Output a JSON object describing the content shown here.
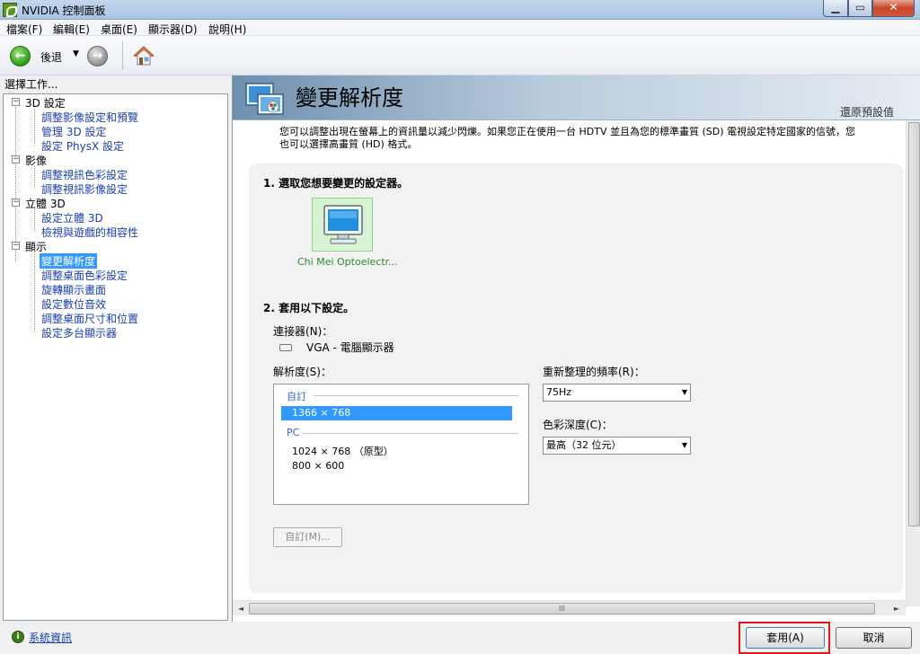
{
  "window": {
    "title": "NVIDIA 控制面板",
    "minimize": "▁",
    "maximize": "▭",
    "close": "✕"
  },
  "menu": [
    "檔案(F)",
    "編輯(E)",
    "桌面(E)",
    "顯示器(D)",
    "說明(H)"
  ],
  "toolbar": {
    "back_label": "後退",
    "dropdown": "▼",
    "back_arrow": "←",
    "forward_arrow": "→"
  },
  "left": {
    "header": "選擇工作...",
    "categories": [
      {
        "label": "3D 設定",
        "toggle": "−",
        "items": [
          "調整影像設定和預覽",
          "管理 3D 設定",
          "設定 PhysX 設定"
        ]
      },
      {
        "label": "影像",
        "toggle": "−",
        "items": [
          "調整視訊色彩設定",
          "調整視訊影像設定"
        ]
      },
      {
        "label": "立體 3D",
        "toggle": "−",
        "items": [
          "設定立體 3D",
          "檢視與遊戲的相容性"
        ]
      },
      {
        "label": "顯示",
        "toggle": "−",
        "items": [
          "變更解析度",
          "調整桌面色彩設定",
          "旋轉顯示畫面",
          "設定數位音效",
          "調整桌面尺寸和位置",
          "設定多台顯示器"
        ]
      }
    ],
    "selected_item": "變更解析度"
  },
  "main": {
    "title": "變更解析度",
    "restore_defaults": "還原預設值",
    "description_line1": "您可以調整出現在螢幕上的資訊量以減少閃爍。如果您正在使用一台 HDTV 並且為您的標準畫質 (SD) 電視設定特定國家的信號，您",
    "description_line2": "也可以選擇高畫質 (HD) 格式。",
    "step1": "1. 選取您想要變更的設定器。",
    "display_name": "Chi Mei Optoelectr...",
    "step2": "2. 套用以下設定。",
    "connector_label": "連接器(N)：",
    "connector_value": "VGA - 電腦顯示器",
    "resolution_label": "解析度(S)：",
    "resolution_groups": [
      {
        "header": "自訂",
        "items": [
          "1366 × 768"
        ]
      },
      {
        "header": "PC",
        "items": [
          "1024 × 768 （原型）",
          "800 × 600"
        ]
      }
    ],
    "selected_resolution": "1366 × 768",
    "refresh_label": "重新整理的頻率(R)：",
    "refresh_value": "75Hz",
    "color_depth_label": "色彩深度(C)：",
    "color_depth_value": "最高（32 位元）",
    "custom_button": "自訂(M)...",
    "hscroll_grip": "III",
    "hscroll_left": "◄",
    "hscroll_right": "►"
  },
  "bottom": {
    "sysinfo_link": "系統資訊",
    "apply": "套用(A)",
    "cancel": "取消"
  },
  "colors": {
    "highlight": "#e0161f",
    "selection": "#3399ff",
    "link": "#1a3fb0",
    "display_tile": "#d8f3d4"
  }
}
